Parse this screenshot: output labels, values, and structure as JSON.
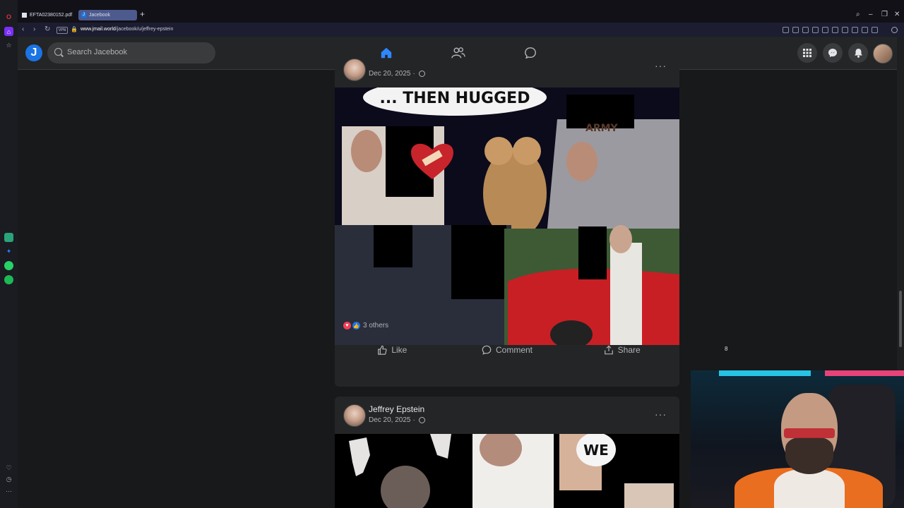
{
  "browser": {
    "tabs": [
      {
        "label": "EFTA02380152.pdf",
        "active": false
      },
      {
        "label": "Jacebook",
        "active": true
      }
    ],
    "new_tab": "+",
    "vpn_label": "VPN",
    "url_domain": "www.jmail.world",
    "url_path": "/jacebook/u/jeffrey-epstein"
  },
  "app": {
    "logo_letter": "J",
    "search_placeholder": "Search Jacebook"
  },
  "posts": [
    {
      "date": "Dec 20, 2025",
      "photo_caption": "... THEN HUGGED",
      "photo_sign": "ARMY",
      "reactions_text": "3 others",
      "actions": [
        "Like",
        "Comment",
        "Share"
      ]
    },
    {
      "author": "Jeffrey Epstein",
      "date": "Dec 20, 2025",
      "photo_caption": "WE"
    }
  ],
  "cursor_label": "8",
  "colors": {
    "accent": "#2d88ff",
    "background": "#18191a",
    "card": "#242526"
  }
}
